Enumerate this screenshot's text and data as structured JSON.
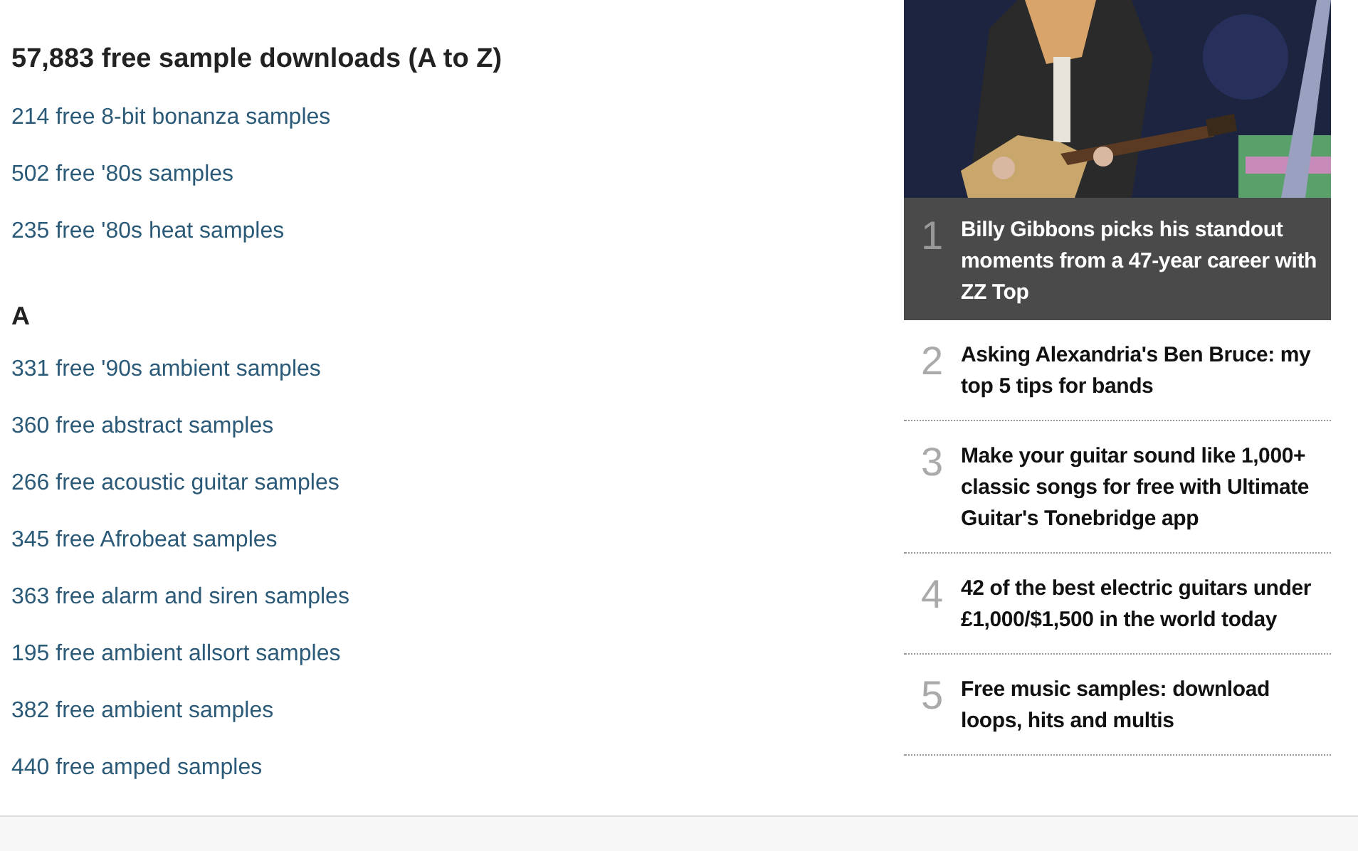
{
  "list": {
    "title": "57,883 free sample downloads (A to Z)",
    "sections": [
      {
        "links": [
          "214 free 8-bit bonanza samples",
          "502 free '80s samples",
          "235 free '80s heat samples"
        ]
      },
      {
        "heading": "A",
        "links": [
          "331 free '90s ambient samples",
          "360 free abstract samples",
          "266 free acoustic guitar samples",
          "345 free Afrobeat samples",
          "363 free alarm and siren samples",
          "195 free ambient allsort samples",
          "382 free ambient samples",
          "440 free amped samples"
        ]
      }
    ]
  },
  "popular": {
    "items": [
      {
        "number": "1",
        "title": "Billy Gibbons picks his standout moments from a 47-year career with ZZ Top",
        "selected": true
      },
      {
        "number": "2",
        "title": "Asking Alexandria's Ben Bruce: my top 5 tips for bands",
        "selected": false
      },
      {
        "number": "3",
        "title": "Make your guitar sound like 1,000+ classic songs for free with Ultimate Guitar's Tonebridge app",
        "selected": false
      },
      {
        "number": "4",
        "title": "42 of the best electric guitars under £1,000/$1,500 in the world today",
        "selected": false
      },
      {
        "number": "5",
        "title": "Free music samples: download loops, hits and multis",
        "selected": false
      }
    ]
  }
}
